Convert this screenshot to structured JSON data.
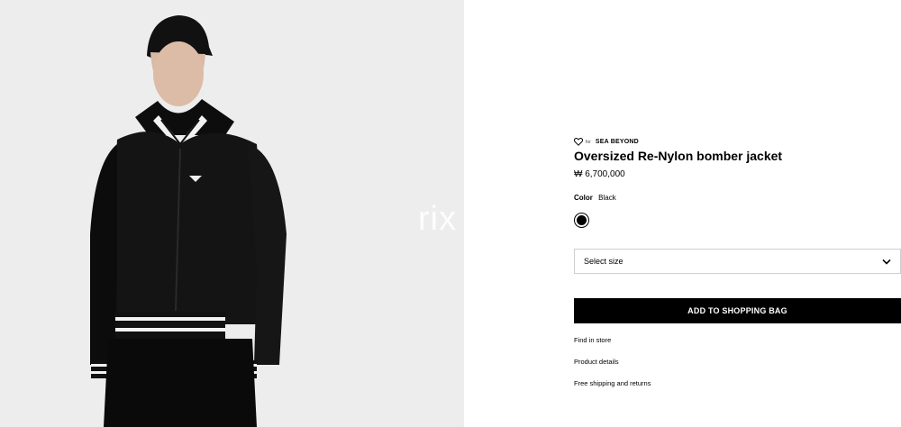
{
  "image": {
    "alt": "Man wearing a black bomber jacket with leather sleeves, striped ribbed trims and a black cap",
    "watermark": "rix"
  },
  "product": {
    "sustainability_prefix": "for",
    "sustainability_brand": "SEA BEYOND",
    "title": "Oversized Re-Nylon bomber jacket",
    "price": "₩ 6,700,000",
    "color_label": "Color",
    "color_value": "Black",
    "swatch_color": "#000000"
  },
  "size_select": {
    "placeholder": "Select size"
  },
  "actions": {
    "add_to_bag": "ADD TO SHOPPING BAG"
  },
  "links": {
    "find_in_store": "Find in store",
    "product_details": "Product details",
    "shipping": "Free shipping and returns"
  },
  "icons": {
    "heart": "heart-icon",
    "chevron": "chevron-down-icon"
  }
}
